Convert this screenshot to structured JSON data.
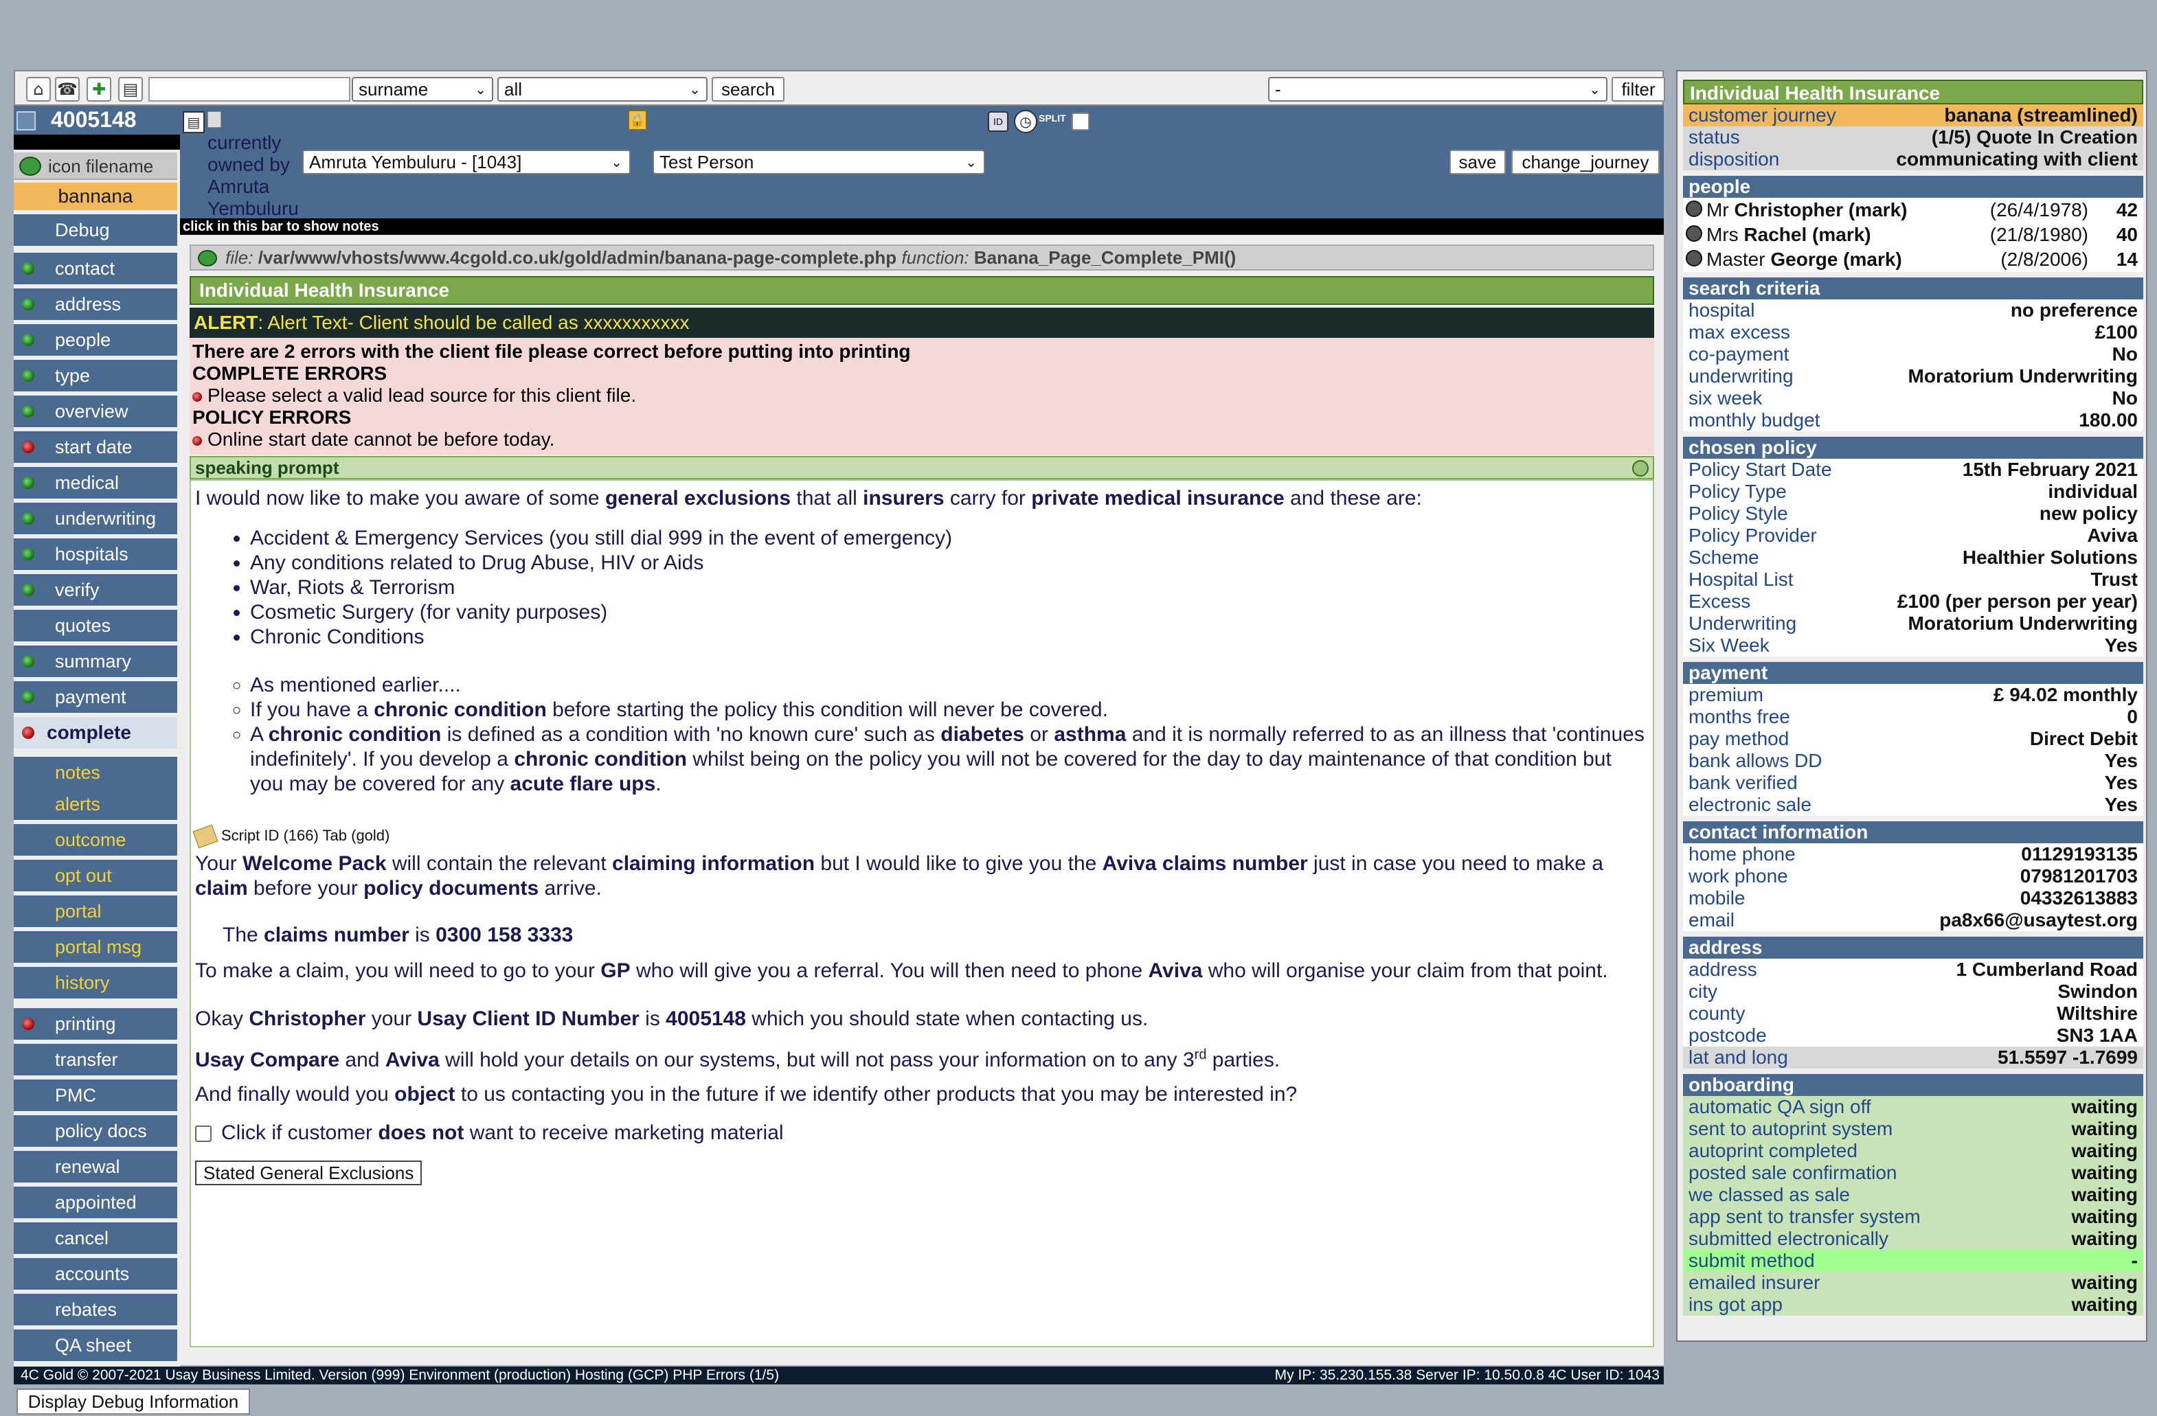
{
  "toolbar": {
    "search_value": "",
    "field_select": "surname",
    "scope_select": "all",
    "search_label": "search",
    "filter_select": "-",
    "filter_label": "filter"
  },
  "client": {
    "id": "4005148",
    "icon_filename_label": "icon filename",
    "client_name": "bannana"
  },
  "nav": {
    "top_items": [
      {
        "label": "Debug",
        "status": "none"
      },
      {
        "label": "contact",
        "status": "green"
      },
      {
        "label": "address",
        "status": "green"
      },
      {
        "label": "people",
        "status": "green"
      },
      {
        "label": "type",
        "status": "green"
      },
      {
        "label": "overview",
        "status": "green"
      },
      {
        "label": "start date",
        "status": "red"
      },
      {
        "label": "medical",
        "status": "green"
      },
      {
        "label": "underwriting",
        "status": "green"
      },
      {
        "label": "hospitals",
        "status": "green"
      },
      {
        "label": "verify",
        "status": "green"
      },
      {
        "label": "quotes",
        "status": "none"
      },
      {
        "label": "summary",
        "status": "green"
      },
      {
        "label": "payment",
        "status": "green"
      },
      {
        "label": "complete",
        "status": "red"
      }
    ],
    "yellow_items": [
      "notes",
      "alerts",
      "outcome",
      "opt out",
      "portal",
      "portal msg",
      "history"
    ],
    "bottom_items": [
      {
        "label": "printing",
        "status": "red"
      },
      {
        "label": "transfer",
        "status": "none"
      },
      {
        "label": "PMC",
        "status": "none"
      },
      {
        "label": "policy docs",
        "status": "none"
      },
      {
        "label": "renewal",
        "status": "none"
      },
      {
        "label": "appointed",
        "status": "none"
      },
      {
        "label": "cancel",
        "status": "none"
      },
      {
        "label": "accounts",
        "status": "none"
      },
      {
        "label": "rebates",
        "status": "none"
      },
      {
        "label": "QA sheet",
        "status": "none"
      }
    ]
  },
  "header": {
    "owned_label": "currently owned by Amruta Yembuluru",
    "owner_select": "Amruta Yembuluru - [1043]",
    "person_select": "Test Person",
    "save_label": "save",
    "change_journey_label": "change_journey",
    "notes_bar": "click in this bar to show notes",
    "split_label": "SPLIT"
  },
  "main": {
    "file_label": "file:",
    "file_path": "/var/www/vhosts/www.4cgold.co.uk/gold/admin/banana-page-complete.php",
    "function_label": "function:",
    "function_name": "Banana_Page_Complete_PMI()",
    "product_title": "Individual Health Insurance",
    "alert_label": "ALERT",
    "alert_text": ": Alert Text- Client should be called as xxxxxxxxxxx",
    "errors_heading": "There are 2 errors with the client file please correct before putting into printing",
    "complete_errors_label": "COMPLETE ERRORS",
    "complete_error": "Please select a valid lead source for this client file.",
    "policy_errors_label": "POLICY ERRORS",
    "policy_error": "Online start date cannot be before today.",
    "speaking_prompt": "speaking prompt",
    "script_intro": [
      "I would now like to make you aware of some ",
      "general exclusions",
      " that all ",
      "insurers",
      " carry for ",
      "private medical insurance",
      " and these are:"
    ],
    "exclusions": [
      "Accident & Emergency Services (you still dial 999 in the event of emergency)",
      "Any conditions related to Drug Abuse, HIV or Aids",
      "War, Riots & Terrorism",
      "Cosmetic Surgery (for vanity purposes)",
      "Chronic Conditions"
    ],
    "chronic_1": "As mentioned earlier....",
    "chronic_2": [
      "If you have a ",
      "chronic condition",
      " before starting the policy this condition will never be covered."
    ],
    "chronic_3": [
      "A ",
      "chronic condition",
      " is defined as a condition with 'no known cure' such as ",
      "diabetes",
      " or ",
      "asthma",
      " and it is normally referred to as an illness that 'continues indefinitely'. If you develop a ",
      "chronic condition",
      " whilst being on the policy you will not be covered for the day to day maintenance of that condition but you may be covered for any ",
      "acute flare ups",
      "."
    ],
    "script_id": "Script ID (166) Tab (gold)",
    "welcome": [
      "Your ",
      "Welcome Pack",
      " will contain the relevant ",
      "claiming information",
      " but I would like to give you the ",
      "Aviva claims number",
      " just in case you need to make a ",
      "claim",
      " before your ",
      "policy documents",
      " arrive."
    ],
    "claims": [
      "The ",
      "claims number",
      " is ",
      "0300 158 3333"
    ],
    "make_claim": [
      "To make a claim, you will need to go to your ",
      "GP",
      " who will give you a referral. You will then need to phone ",
      "Aviva",
      " who will organise your claim from that point."
    ],
    "okay": [
      "Okay ",
      "Christopher",
      " your ",
      "Usay Client ID Number",
      " is ",
      "4005148",
      " which you should state when contacting us."
    ],
    "usay_a": "Usay Compare",
    "usay_b": " and ",
    "usay_c": "Aviva",
    "usay_d": " will hold your details on our systems, but will not pass your information on to any 3",
    "usay_sup": "rd",
    "usay_e": " parties.",
    "finally": [
      "And finally would you ",
      "object",
      " to us contacting you in the future if we identify other products that you may be interested in?"
    ],
    "checkbox": [
      "Click if customer ",
      "does not",
      " want to receive marketing material"
    ],
    "stated_btn": "Stated General Exclusions"
  },
  "footer": {
    "left": "4C Gold © 2007-2021 Usay Business Limited. Version (999) Environment (production) Hosting (GCP) PHP Errors (1/5)",
    "right": "My IP: 35.230.155.38 Server IP: 10.50.0.8 4C User ID: 1043",
    "debug_btn": "Display Debug Information"
  },
  "panel": {
    "title": "Individual Health Insurance",
    "top": [
      {
        "k": "customer journey",
        "v": "banana (streamlined)"
      },
      {
        "k": "status",
        "v": "(1/5) Quote In Creation"
      },
      {
        "k": "disposition",
        "v": "communicating with client"
      }
    ],
    "people_head": "people",
    "people": [
      {
        "title": "Mr ",
        "name": "Christopher (mark)",
        "dob": "(26/4/1978)",
        "age": "42"
      },
      {
        "title": "Mrs ",
        "name": "Rachel (mark)",
        "dob": "(21/8/1980)",
        "age": "40"
      },
      {
        "title": "Master ",
        "name": "George (mark)",
        "dob": "(2/8/2006)",
        "age": "14"
      }
    ],
    "search_head": "search criteria",
    "search": [
      {
        "k": "hospital",
        "v": "no preference"
      },
      {
        "k": "max excess",
        "v": "£100"
      },
      {
        "k": "co-payment",
        "v": "No"
      },
      {
        "k": "underwriting",
        "v": "Moratorium Underwriting"
      },
      {
        "k": "six week",
        "v": "No"
      },
      {
        "k": "monthly budget",
        "v": "180.00"
      }
    ],
    "policy_head": "chosen policy",
    "policy": [
      {
        "k": "Policy Start Date",
        "v": "15th February 2021"
      },
      {
        "k": "Policy Type",
        "v": "individual"
      },
      {
        "k": "Policy Style",
        "v": "new policy"
      },
      {
        "k": "Policy Provider",
        "v": "Aviva"
      },
      {
        "k": "Scheme",
        "v": "Healthier Solutions"
      },
      {
        "k": "Hospital List",
        "v": "Trust"
      },
      {
        "k": "Excess",
        "v": "£100 (per person per year)"
      },
      {
        "k": "Underwriting",
        "v": "Moratorium Underwriting"
      },
      {
        "k": "Six Week",
        "v": "Yes"
      }
    ],
    "payment_head": "payment",
    "payment": [
      {
        "k": "premium",
        "v": "£ 94.02 monthly"
      },
      {
        "k": "months free",
        "v": "0"
      },
      {
        "k": "pay method",
        "v": "Direct Debit"
      },
      {
        "k": "bank allows DD",
        "v": "Yes"
      },
      {
        "k": "bank verified",
        "v": "Yes"
      },
      {
        "k": "electronic sale",
        "v": "Yes"
      }
    ],
    "contact_head": "contact information",
    "contact": [
      {
        "k": "home phone",
        "v": "01129193135"
      },
      {
        "k": "work phone",
        "v": "07981201703"
      },
      {
        "k": "mobile",
        "v": "04332613883"
      },
      {
        "k": "email",
        "v": "pa8x66@usaytest.org"
      }
    ],
    "address_head": "address",
    "address": [
      {
        "k": "address",
        "v": "1 Cumberland Road"
      },
      {
        "k": "city",
        "v": "Swindon"
      },
      {
        "k": "county",
        "v": "Wiltshire"
      },
      {
        "k": "postcode",
        "v": "SN3 1AA"
      },
      {
        "k": "lat and long",
        "v": "51.5597 -1.7699"
      }
    ],
    "onboarding_head": "onboarding",
    "onboarding": [
      {
        "k": "automatic QA sign off",
        "v": "waiting"
      },
      {
        "k": "sent to autoprint system",
        "v": "waiting"
      },
      {
        "k": "autoprint completed",
        "v": "waiting"
      },
      {
        "k": "posted sale confirmation",
        "v": "waiting"
      },
      {
        "k": "we classed as sale",
        "v": "waiting"
      },
      {
        "k": "app sent to transfer system",
        "v": "waiting"
      },
      {
        "k": "submitted electronically",
        "v": "waiting"
      },
      {
        "k": "submit method",
        "v": "-"
      },
      {
        "k": "emailed insurer",
        "v": "waiting"
      },
      {
        "k": "ins got app",
        "v": "waiting"
      }
    ]
  }
}
